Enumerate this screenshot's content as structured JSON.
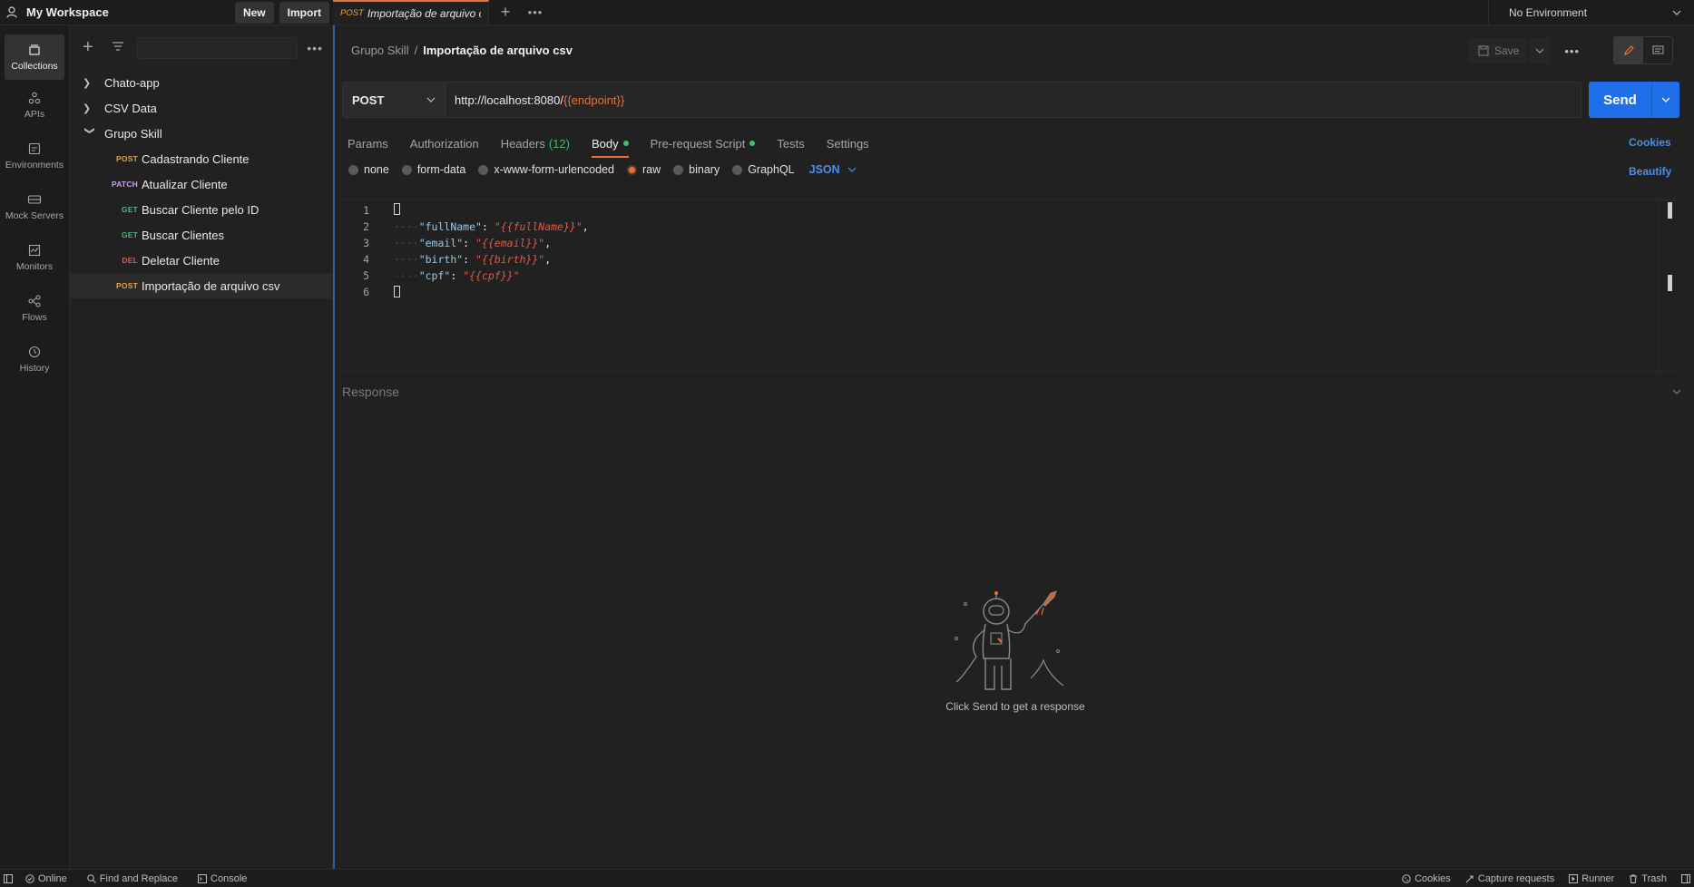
{
  "workspace": {
    "title": "My Workspace",
    "new_label": "New",
    "import_label": "Import"
  },
  "rail": [
    {
      "label": "Collections",
      "icon": "collections-icon"
    },
    {
      "label": "APIs",
      "icon": "apis-icon"
    },
    {
      "label": "Environments",
      "icon": "environments-icon"
    },
    {
      "label": "Mock Servers",
      "icon": "mock-servers-icon"
    },
    {
      "label": "Monitors",
      "icon": "monitors-icon"
    },
    {
      "label": "Flows",
      "icon": "flows-icon"
    },
    {
      "label": "History",
      "icon": "history-icon"
    }
  ],
  "sidebar": {
    "collections": [
      {
        "name": "Chato-app"
      },
      {
        "name": "CSV Data"
      },
      {
        "name": "Grupo Skill"
      }
    ],
    "requests": [
      {
        "method": "POST",
        "name": "Cadastrando Cliente"
      },
      {
        "method": "PATCH",
        "name": "Atualizar Cliente"
      },
      {
        "method": "GET",
        "name": "Buscar Cliente pelo ID"
      },
      {
        "method": "GET",
        "name": "Buscar Clientes"
      },
      {
        "method": "DEL",
        "name": "Deletar Cliente"
      },
      {
        "method": "POST",
        "name": "Importação de arquivo csv"
      }
    ]
  },
  "tab": {
    "method": "POST",
    "name": "Importação de arquivo c"
  },
  "environment": {
    "label": "No Environment"
  },
  "breadcrumb": {
    "parent": "Grupo Skill",
    "separator": "/",
    "current": "Importação de arquivo csv"
  },
  "toolbar": {
    "save_label": "Save"
  },
  "request": {
    "method": "POST",
    "url_base": "http://localhost:8080/",
    "url_var": "{{endpoint}}",
    "send_label": "Send"
  },
  "req_tabs": {
    "params": "Params",
    "authorization": "Authorization",
    "headers": "Headers",
    "headers_count": "(12)",
    "body": "Body",
    "prerequest": "Pre-request Script",
    "tests": "Tests",
    "settings": "Settings",
    "cookies": "Cookies"
  },
  "body_options": {
    "none": "none",
    "form_data": "form-data",
    "urlencoded": "x-www-form-urlencoded",
    "raw": "raw",
    "binary": "binary",
    "graphql": "GraphQL",
    "format": "JSON",
    "beautify": "Beautify"
  },
  "editor": {
    "line_numbers": [
      "1",
      "2",
      "3",
      "4",
      "5",
      "6"
    ],
    "lines": [
      {
        "key": "\"fullName\"",
        "value": "\"{{fullName}}\"",
        "trail": ","
      },
      {
        "key": "\"email\"",
        "value": "\"{{email}}\"",
        "trail": ","
      },
      {
        "key": "\"birth\"",
        "value": "\"{{birth}}\"",
        "trail": ","
      },
      {
        "key": "\"cpf\"",
        "value": "\"{{cpf}}\"",
        "trail": ""
      }
    ]
  },
  "response": {
    "label": "Response",
    "empty_text": "Click Send to get a response"
  },
  "statusbar": {
    "online": "Online",
    "find_replace": "Find and Replace",
    "console": "Console",
    "cookies": "Cookies",
    "capture": "Capture requests",
    "runner": "Runner",
    "trash": "Trash"
  },
  "colors": {
    "accent": "#e8713a",
    "send": "#1f6feb",
    "link": "#4d8ee8"
  }
}
